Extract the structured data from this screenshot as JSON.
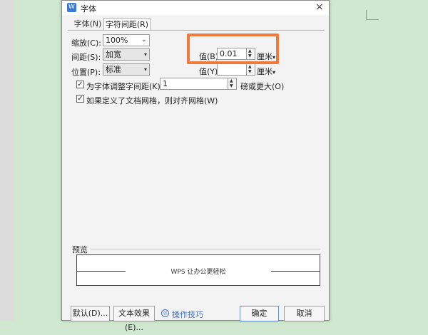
{
  "dialog": {
    "app_icon": "W",
    "title": "字体",
    "close_icon": "×"
  },
  "tabs": [
    {
      "label": "字体(N)",
      "active": false
    },
    {
      "label": "字符间距(R)",
      "active": true
    }
  ],
  "scale": {
    "label": "缩放(C):",
    "value": "100%"
  },
  "spacing": {
    "label": "间距(S):",
    "value": "加宽",
    "value_label": "值(B):",
    "value_text": "0.01",
    "unit": "厘米",
    "unit_arrow": "▾"
  },
  "position": {
    "label": "位置(P):",
    "value": "标准",
    "value_label": "值(Y):",
    "value_text": "",
    "unit": "厘米",
    "unit_arrow": "▾"
  },
  "kerning": {
    "checked": true,
    "check_glyph": "✓",
    "label": "为字体调整字间距(K):",
    "value": "1",
    "suffix": "磅或更大(O)"
  },
  "grid": {
    "checked": true,
    "check_glyph": "✓",
    "label": "如果定义了文档网格，则对齐网格(W)"
  },
  "preview": {
    "label": "预览",
    "text": "WPS 让办公更轻松"
  },
  "buttons": {
    "default": "默认(D)...",
    "text_effects": "文本效果(E)...",
    "tips": "操作技巧",
    "ok": "确定",
    "cancel": "取消"
  },
  "icons": {
    "dropdown": "▾",
    "chevron": "⌄",
    "spin_up": "▲",
    "spin_down": "▼",
    "tips_icon": "◎"
  },
  "colors": {
    "highlight": "#ee7a3b",
    "background": "#cfe8cf",
    "link": "#3b6fd0"
  }
}
